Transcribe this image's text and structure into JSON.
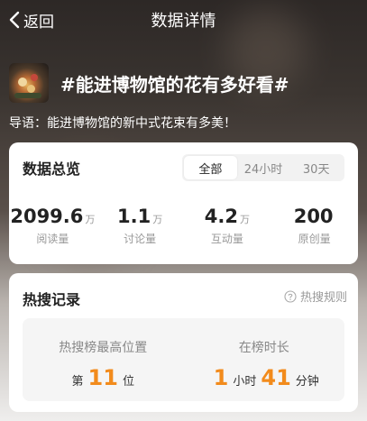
{
  "nav": {
    "back_label": "返回",
    "title": "数据详情"
  },
  "topic": {
    "title": "#能进博物馆的花有多好看#",
    "intro": "导语：能进博物馆的新中式花束有多美！"
  },
  "overview": {
    "title": "数据总览",
    "tabs": [
      {
        "label": "全部",
        "active": true
      },
      {
        "label": "24小时",
        "active": false
      },
      {
        "label": "30天",
        "active": false
      }
    ],
    "stats": [
      {
        "value": "2099.6",
        "unit": "万",
        "label": "阅读量"
      },
      {
        "value": "1.1",
        "unit": "万",
        "label": "讨论量"
      },
      {
        "value": "4.2",
        "unit": "万",
        "label": "互动量"
      },
      {
        "value": "200",
        "unit": "",
        "label": "原创量"
      }
    ]
  },
  "hot": {
    "title": "热搜记录",
    "rules_label": "热搜规则",
    "best_rank": {
      "label": "热搜榜最高位置",
      "prefix": "第",
      "value": "11",
      "suffix": "位"
    },
    "duration": {
      "label": "在榜时长",
      "hours": "1",
      "hours_unit": "小时",
      "minutes": "41",
      "minutes_unit": "分钟"
    }
  },
  "colors": {
    "accent": "#f28b1c"
  }
}
